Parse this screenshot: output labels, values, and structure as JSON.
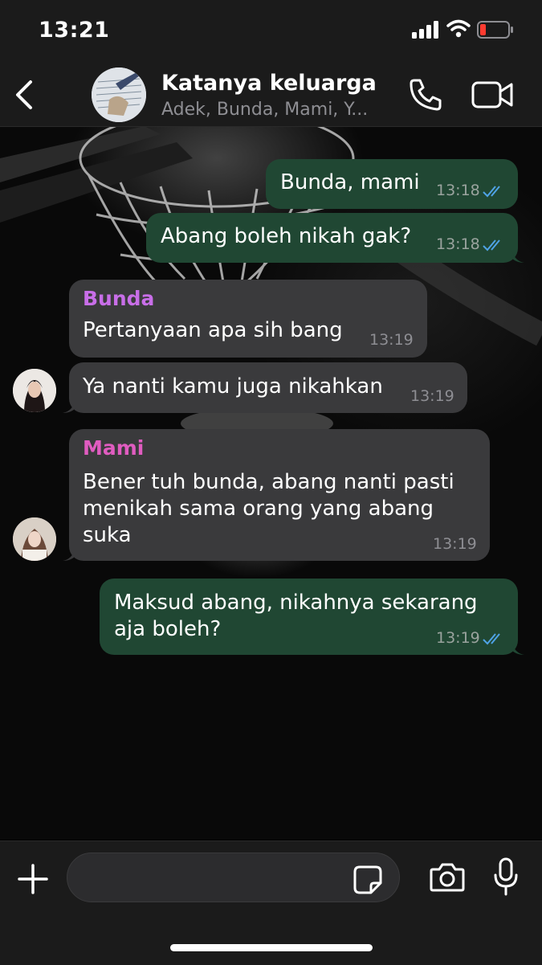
{
  "status_bar": {
    "time": "13:21"
  },
  "header": {
    "title": "Katanya keluarga",
    "subtitle": "Adek, Bunda, Mami, Y..."
  },
  "messages": [
    {
      "direction": "out",
      "text": "Bunda, mami",
      "time": "13:18",
      "read": true
    },
    {
      "direction": "out",
      "text": "Abang boleh nikah gak?",
      "time": "13:18",
      "read": true
    },
    {
      "direction": "in",
      "sender": "Bunda",
      "sender_color": "#c86ee8",
      "text": "Pertanyaan apa sih bang",
      "time": "13:19"
    },
    {
      "direction": "in",
      "text": "Ya nanti kamu juga nikahkan",
      "time": "13:19"
    },
    {
      "direction": "in",
      "sender": "Mami",
      "sender_color": "#e05cc0",
      "lines": [
        "Bener tuh bunda, abang nanti pasti",
        "menikah sama orang yang abang",
        "suka"
      ],
      "time": "13:19"
    },
    {
      "direction": "out",
      "lines": [
        "Maksud abang, nikahnya sekarang",
        "aja boleh?"
      ],
      "time": "13:19",
      "read": true
    }
  ],
  "composer": {
    "input_value": ""
  },
  "colors": {
    "outgoing_bubble": "#204733",
    "incoming_bubble": "#3a3a3c",
    "read_ticks": "#4fa3e6"
  },
  "icons": [
    "back-chevron-icon",
    "phone-icon",
    "video-camera-icon",
    "plus-icon",
    "sticker-icon",
    "camera-icon",
    "microphone-icon",
    "signal-icon",
    "wifi-icon",
    "battery-icon"
  ]
}
